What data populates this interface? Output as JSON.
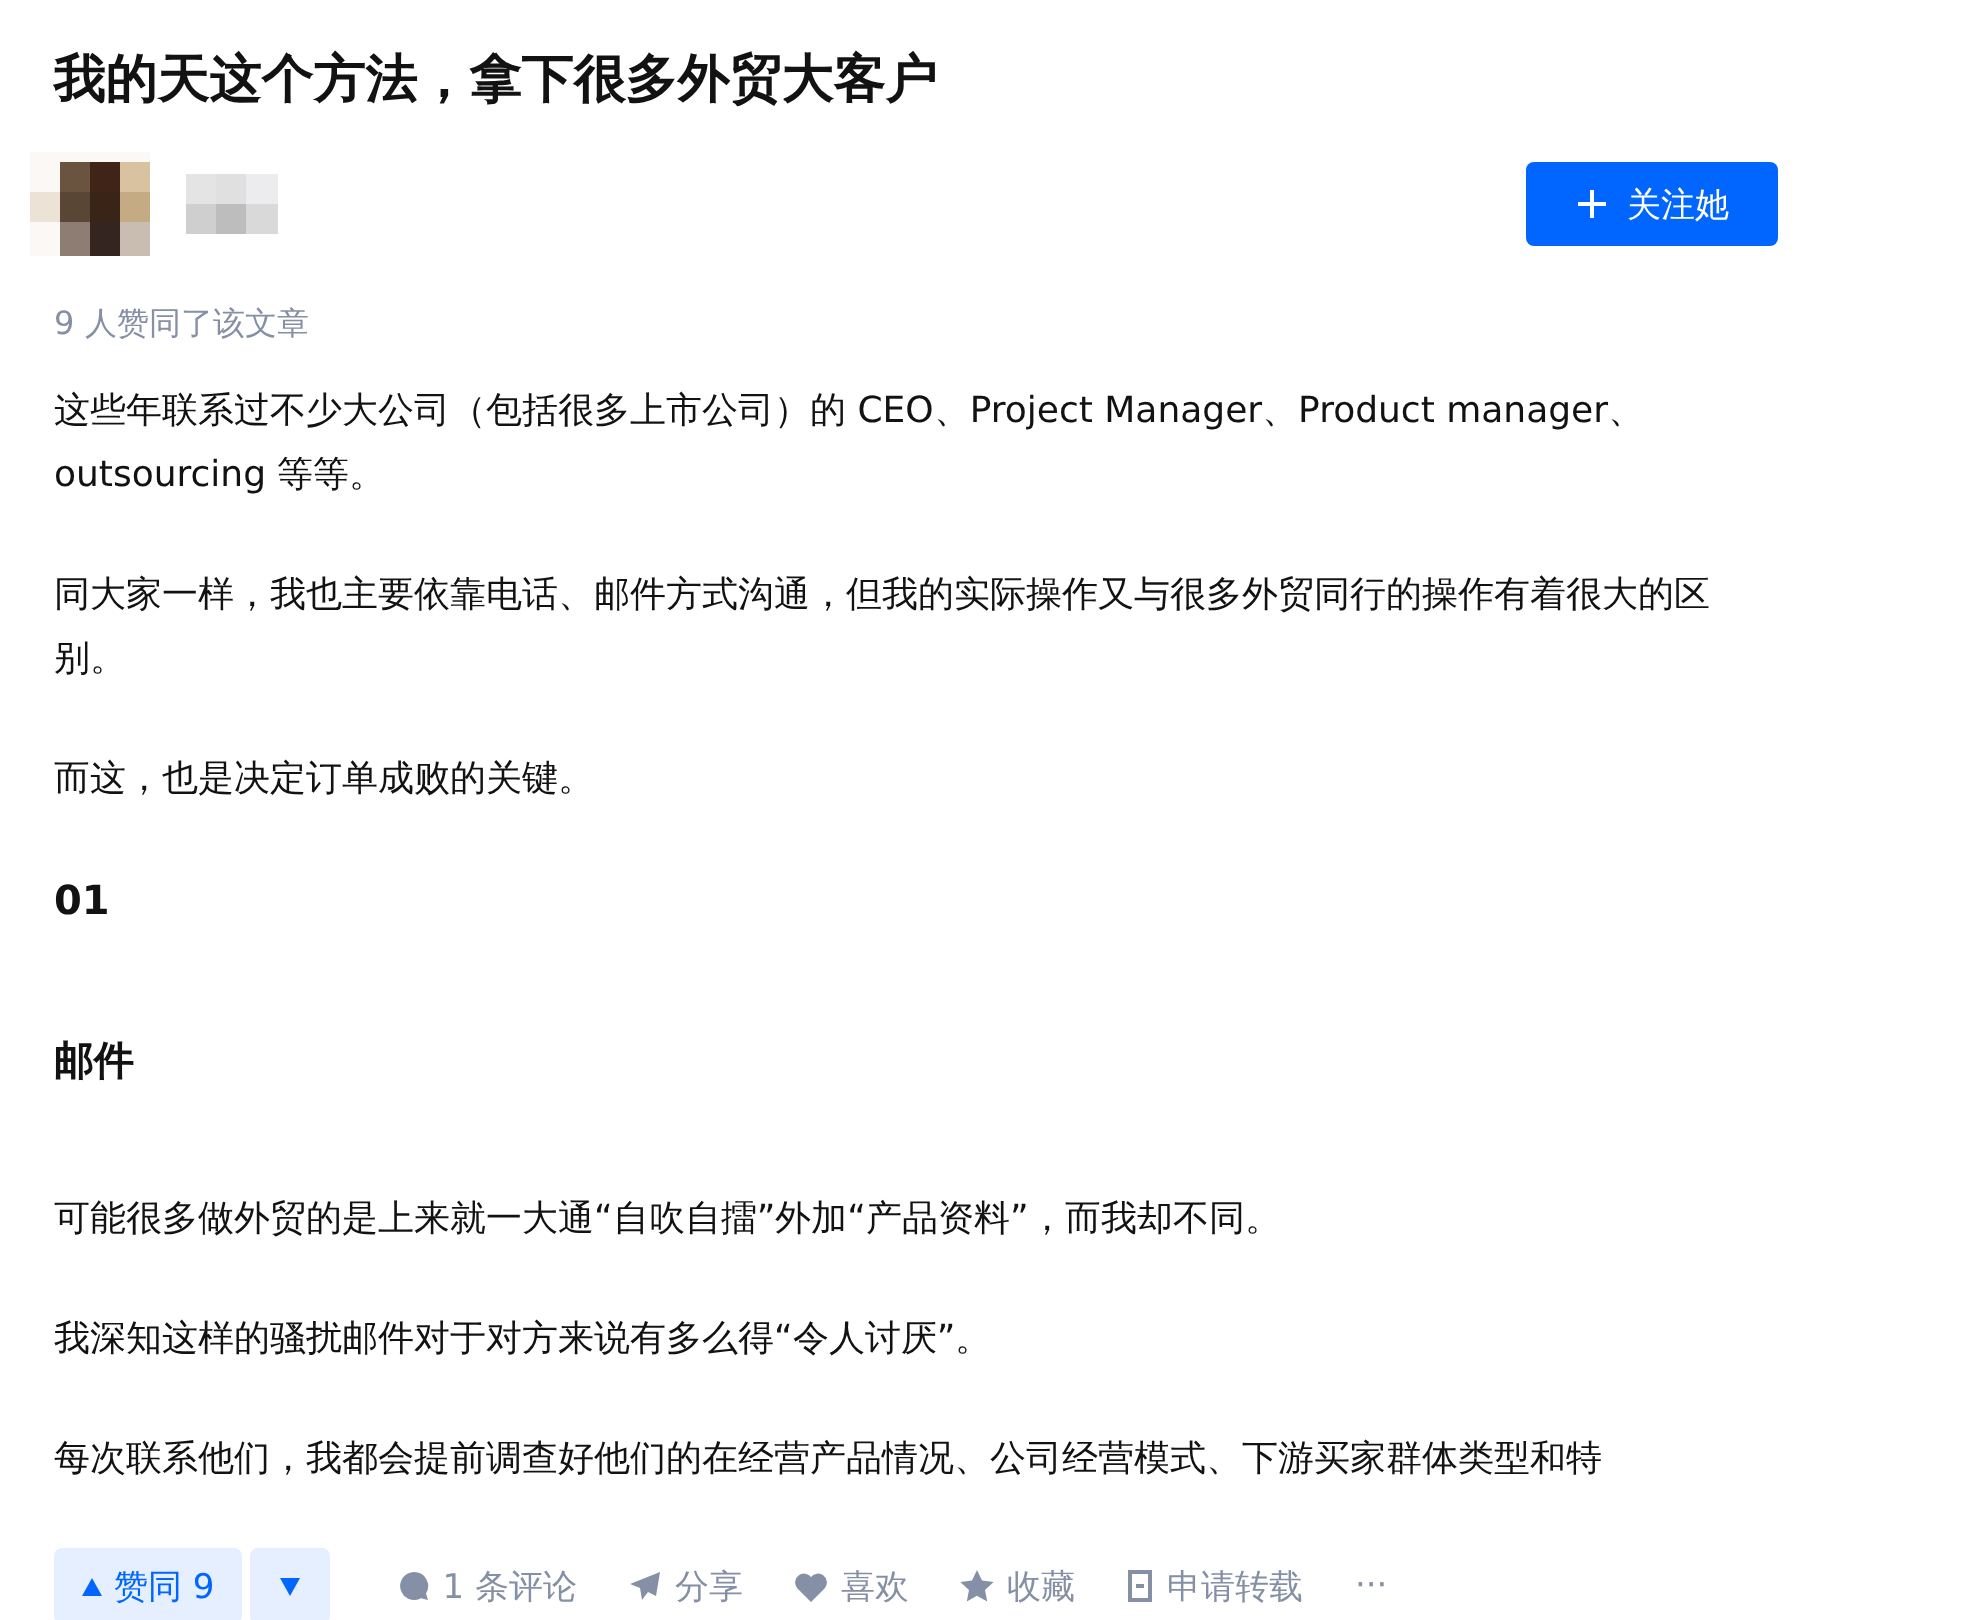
{
  "title": "我的天这个方法，拿下很多外贸大客户",
  "author": {
    "follow_button": "关注她"
  },
  "upvote_summary": "9 人赞同了该文章",
  "content": [
    {
      "kind": "paragraph",
      "text": "这些年联系过不少大公司（包括很多上市公司）的 CEO、Project Manager、Product manager、outsourcing 等等。"
    },
    {
      "kind": "paragraph",
      "text": "同大家一样，我也主要依靠电话、邮件方式沟通，但我的实际操作又与很多外贸同行的操作有着很大的区别。"
    },
    {
      "kind": "paragraph",
      "text": "而这，也是决定订单成败的关键。"
    },
    {
      "kind": "heading",
      "text": "01"
    },
    {
      "kind": "heading",
      "text": "邮件"
    },
    {
      "kind": "paragraph",
      "text": "可能很多做外贸的是上来就一大通“自吹自擂”外加“产品资料”，而我却不同。"
    },
    {
      "kind": "paragraph",
      "text": "我深知这样的骚扰邮件对于对方来说有多么得“令人讨厌”。"
    },
    {
      "kind": "paragraph",
      "text": "每次联系他们，我都会提前调查好他们的在经营产品情况、公司经营模式、下游买家群体类型和特"
    }
  ],
  "vote": {
    "up_label": "赞同 9"
  },
  "actions": [
    {
      "kind": "comment",
      "label": "1 条评论"
    },
    {
      "kind": "share",
      "label": "分享"
    },
    {
      "kind": "like",
      "label": "喜欢"
    },
    {
      "kind": "favorite",
      "label": "收藏"
    },
    {
      "kind": "reprint",
      "label": "申请转载"
    },
    {
      "kind": "more",
      "label": "···"
    }
  ]
}
